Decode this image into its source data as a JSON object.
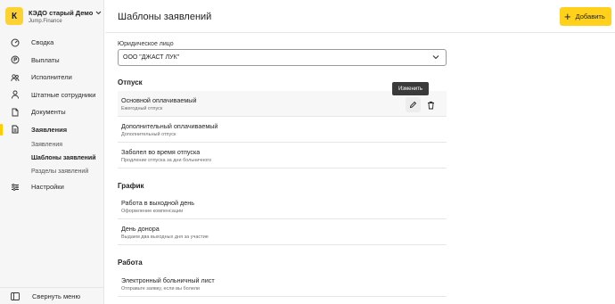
{
  "sidebar": {
    "org": {
      "avatar_letter": "К",
      "name": "КЭДО старый Демо",
      "subtitle": "Jump.Finance"
    },
    "items": [
      {
        "label": "Сводка",
        "icon": "dashboard-icon"
      },
      {
        "label": "Выплаты",
        "icon": "payments-icon"
      },
      {
        "label": "Исполнители",
        "icon": "contractors-icon"
      },
      {
        "label": "Штатные сотрудники",
        "icon": "employees-icon"
      },
      {
        "label": "Документы",
        "icon": "documents-icon"
      },
      {
        "label": "Заявления",
        "icon": "applications-icon"
      },
      {
        "label": "Настройки",
        "icon": "settings-icon"
      }
    ],
    "subitems": [
      {
        "label": "Заявления"
      },
      {
        "label": "Шаблоны заявлений"
      },
      {
        "label": "Разделы заявлений"
      }
    ],
    "collapse_label": "Свернуть меню"
  },
  "header": {
    "title": "Шаблоны заявлений",
    "add_label": "Добавить"
  },
  "filter": {
    "label": "Юридическое лицо",
    "value": "ООО \"ДЖАСТ ЛУК\""
  },
  "sections": [
    {
      "title": "Отпуск",
      "rows": [
        {
          "title": "Основной оплачиваемый",
          "subtitle": "Ежегодный отпуск"
        },
        {
          "title": "Дополнительный оплачиваемый",
          "subtitle": "Дополнительный отпуск"
        },
        {
          "title": "Заболел во время отпуска",
          "subtitle": "Продление отпуска за дни больничного"
        }
      ]
    },
    {
      "title": "График",
      "rows": [
        {
          "title": "Работа в выходной день",
          "subtitle": "Оформление компенсации"
        },
        {
          "title": "День донора",
          "subtitle": "Выдаем два выходных дня за участие"
        }
      ]
    },
    {
      "title": "Работа",
      "rows": [
        {
          "title": "Электронный больничный лист",
          "subtitle": "Отправьте заявку, если вы болели"
        }
      ]
    }
  ],
  "tooltip": "Изменить",
  "colors": {
    "accent": "#ffd11a",
    "sidebar_bg": "#f6f6f6"
  }
}
